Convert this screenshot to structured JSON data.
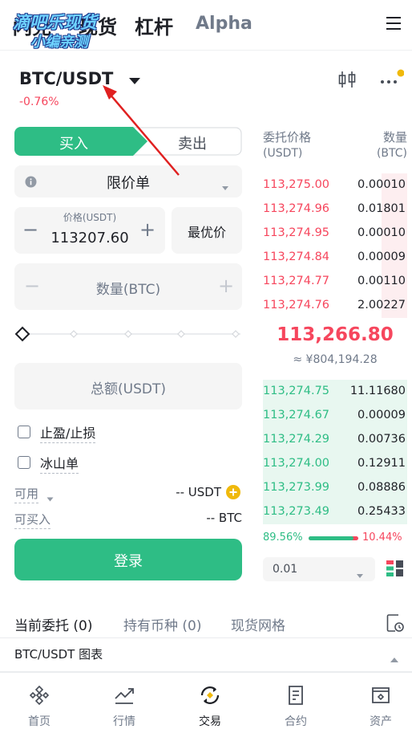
{
  "header": {
    "tabs": [
      "闪兑",
      "现货",
      "杠杆",
      "Alpha"
    ],
    "watermark_line1": "滴吧乐现货",
    "watermark_line2": "小编亲测"
  },
  "pair": {
    "symbol": "BTC/USDT",
    "change": "-0.76%"
  },
  "order_form": {
    "buy_label": "买入",
    "sell_label": "卖出",
    "order_type": "限价单",
    "price_label": "价格(USDT)",
    "price_value": "113207.60",
    "best_price_label": "最优价",
    "quantity_placeholder": "数量(BTC)",
    "total_placeholder": "总额(USDT)",
    "tp_sl_label": "止盈/止损",
    "iceberg_label": "冰山单",
    "available_label": "可用",
    "available_value": "-- USDT",
    "can_buy_label": "可买入",
    "can_buy_value": "-- BTC",
    "login_label": "登录",
    "minus": "−",
    "plus": "+"
  },
  "order_book": {
    "price_header": "委托价格",
    "price_unit": "(USDT)",
    "qty_header": "数量",
    "qty_unit": "(BTC)",
    "asks": [
      {
        "price": "113,275.00",
        "qty": "0.00010",
        "depth": 0.18
      },
      {
        "price": "113,274.96",
        "qty": "0.01801",
        "depth": 0.18
      },
      {
        "price": "113,274.95",
        "qty": "0.00010",
        "depth": 0.18
      },
      {
        "price": "113,274.84",
        "qty": "0.00009",
        "depth": 0.18
      },
      {
        "price": "113,274.77",
        "qty": "0.00110",
        "depth": 0.18
      },
      {
        "price": "113,274.76",
        "qty": "2.00227",
        "depth": 0.18
      }
    ],
    "last_price": "113,266.80",
    "last_price_cny": "≈ ¥804,194.28",
    "bids": [
      {
        "price": "113,274.75",
        "qty": "11.11680",
        "depth": 1.0
      },
      {
        "price": "113,274.67",
        "qty": "0.00009",
        "depth": 1.0
      },
      {
        "price": "113,274.29",
        "qty": "0.00736",
        "depth": 1.0
      },
      {
        "price": "113,274.00",
        "qty": "0.12911",
        "depth": 1.0
      },
      {
        "price": "113,273.99",
        "qty": "0.08886",
        "depth": 1.0
      },
      {
        "price": "113,273.49",
        "qty": "0.25433",
        "depth": 1.0
      }
    ],
    "buy_ratio": "89.56%",
    "sell_ratio": "10.44%",
    "buy_ratio_value": 0.8956,
    "precision": "0.01"
  },
  "bottom_tabs": {
    "open_orders": "当前委托 (0)",
    "holdings": "持有币种 (0)",
    "grid": "现货网格"
  },
  "chart_bar": {
    "label": "BTC/USDT 图表"
  },
  "nav": [
    "首页",
    "行情",
    "交易",
    "合约",
    "资产"
  ],
  "colors": {
    "green": "#2ebd85",
    "red": "#f6465d",
    "yellow": "#f0b90b",
    "arrow": "#e02020"
  }
}
